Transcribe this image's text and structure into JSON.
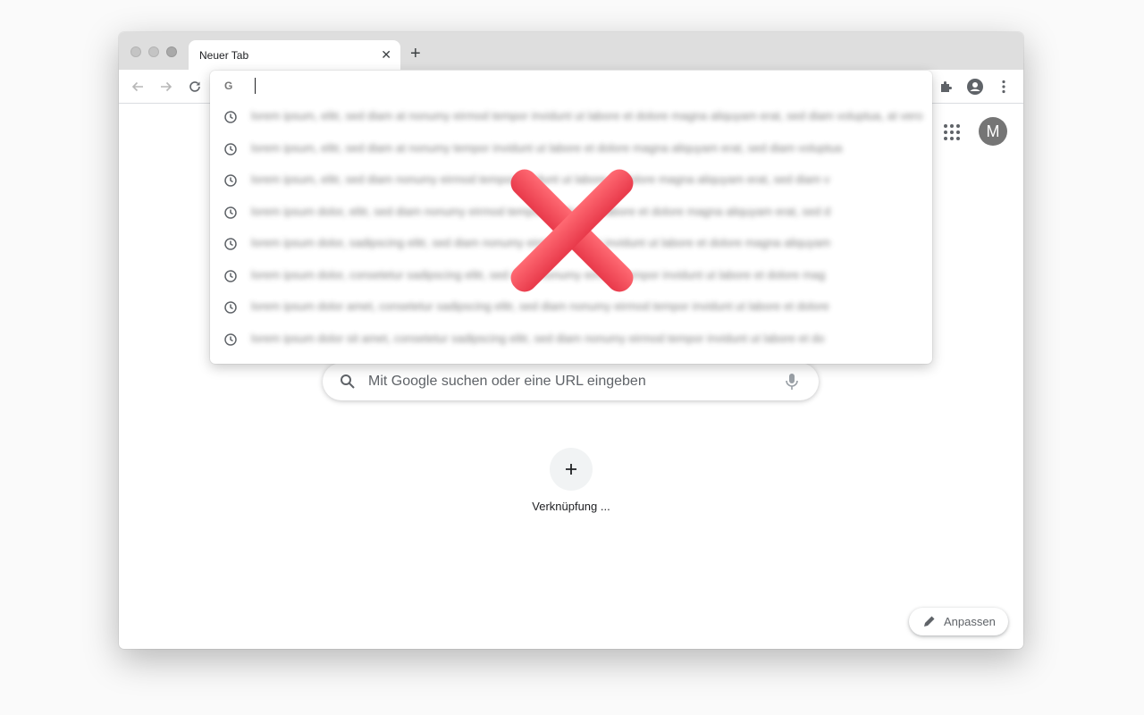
{
  "tabs": [
    {
      "title": "Neuer Tab",
      "close_icon": "close-icon"
    }
  ],
  "tabstrip": {
    "new_tab_icon": "plus-icon"
  },
  "toolbar": {
    "back_icon": "arrow-back-icon",
    "forward_icon": "arrow-forward-icon",
    "reload_icon": "reload-icon",
    "extensions_icon": "puzzle-piece-icon",
    "profile_icon": "account-circle-icon",
    "menu_icon": "kebab-menu-icon"
  },
  "omnibox": {
    "value": "",
    "provider_icon": "google-g-icon",
    "suggestions": [
      {
        "icon": "history-icon",
        "text": "lorem ipsum, elitr, sed diam at nonumy eirmod tempor invidunt ut labore et dolore magna aliquyam erat, sed diam voluptua, at vero"
      },
      {
        "icon": "history-icon",
        "text": "lorem ipsum, elitr, sed diam at nonumy tempor invidunt ut labore et dolore magna aliquyam erat, sed diam voluptua"
      },
      {
        "icon": "history-icon",
        "text": "lorem ipsum, elitr, sed diam nonumy eirmod tempor invidunt ut labore et dolore magna aliquyam erat, sed diam v"
      },
      {
        "icon": "history-icon",
        "text": "lorem ipsum dolor, elitr, sed diam nonumy eirmod tempor invidunt ut labore et dolore magna aliquyam erat, sed d"
      },
      {
        "icon": "history-icon",
        "text": "lorem ipsum dolor, sadipscing elitr, sed diam nonumy eirmod tempor invidunt ut labore et dolore magna aliquyam"
      },
      {
        "icon": "history-icon",
        "text": "lorem ipsum dolor, consetetur sadipscing elitr, sed diam nonumy eirmod tempor invidunt ut labore et dolore mag"
      },
      {
        "icon": "history-icon",
        "text": "lorem ipsum dolor amet, consetetur sadipscing elitr, sed diam nonumy eirmod tempor invidunt ut labore et dolore"
      },
      {
        "icon": "history-icon",
        "text": "lorem ipsum dolor sit amet, consetetur sadipscing elitr, sed diam nonumy eirmod tempor invidunt ut labore et do"
      }
    ]
  },
  "overlay": {
    "icon": "red-cross-icon",
    "color": "#f04a55"
  },
  "ntp": {
    "apps_icon": "apps-grid-icon",
    "avatar_letter": "M",
    "avatar_color": "#757575",
    "search": {
      "placeholder": "Mit Google suchen oder eine URL eingeben",
      "search_icon": "search-icon",
      "mic_icon": "microphone-icon"
    },
    "shortcut": {
      "label": "Verknüpfung ...",
      "icon": "plus-icon"
    },
    "customize": {
      "label": "Anpassen",
      "icon": "pencil-icon"
    }
  }
}
